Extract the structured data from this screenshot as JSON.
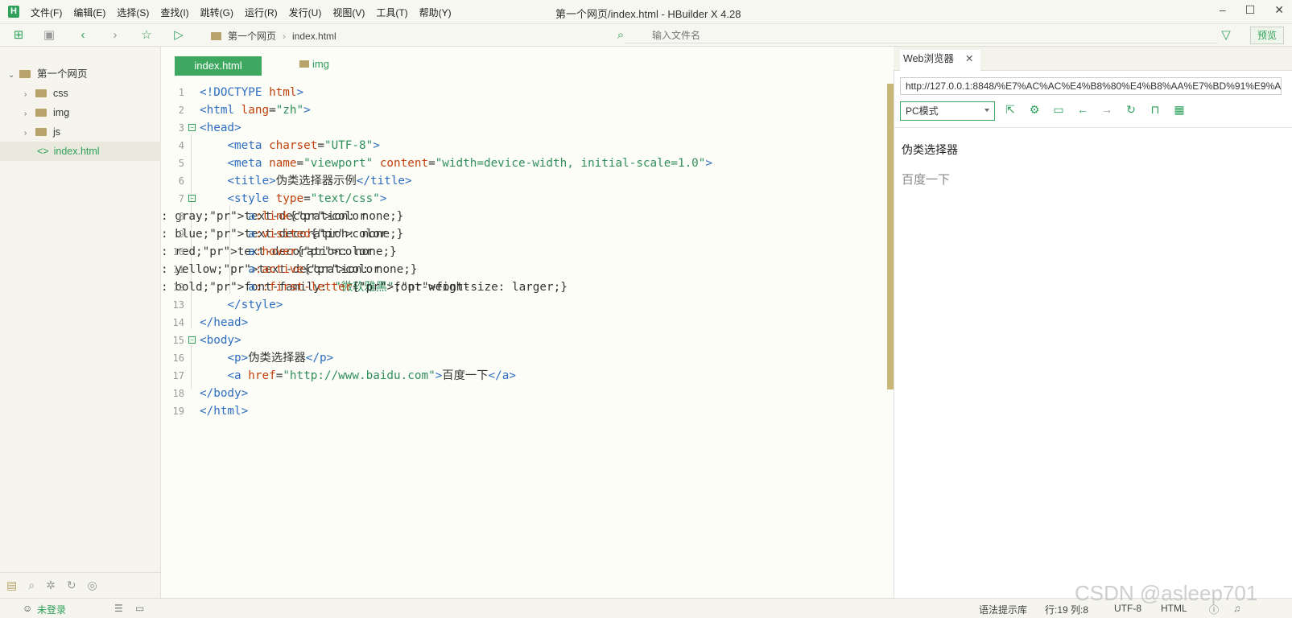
{
  "app": {
    "logo": "H",
    "title": "第一个网页/index.html - HBuilder X 4.28"
  },
  "menu": [
    "文件(F)",
    "编辑(E)",
    "选择(S)",
    "查找(I)",
    "跳转(G)",
    "运行(R)",
    "发行(U)",
    "视图(V)",
    "工具(T)",
    "帮助(Y)"
  ],
  "toolbar": {
    "crumb_project": "第一个网页",
    "crumb_file": "index.html",
    "search_placeholder": "输入文件名",
    "preview_label": "预览"
  },
  "sidebar": {
    "project": "第一个网页",
    "items": [
      {
        "label": "css"
      },
      {
        "label": "img"
      },
      {
        "label": "js"
      },
      {
        "label": "index.html"
      }
    ]
  },
  "tabs": [
    {
      "label": "index.html"
    },
    {
      "label": "img"
    }
  ],
  "code_lines": [
    "<!DOCTYPE html>",
    "<html lang=\"zh\">",
    "<head>",
    "    <meta charset=\"UTF-8\">",
    "    <meta name=\"viewport\" content=\"width=device-width, initial-scale=1.0\">",
    "    <title>伪类选择器示例</title>",
    "    <style type=\"text/css\">",
    "       a:link{color: gray;text-decoration: none;}",
    "       a:visited{color: blue;text-decoration: none;}",
    "       a:hover{color: red;text-decoration: none;}",
    "       a:active{color: yellow;text-decoration: none;}",
    "       a::first-letter{font-weight: bold;font-family: \"微软雅黑\";font-size: larger;}",
    "    </style>",
    "</head>",
    "<body>",
    "    <p>伪类选择器</p>",
    "    <a href=\"http://www.baidu.com\">百度一下</a>",
    "</body>",
    "</html>"
  ],
  "browser": {
    "tab_label": "Web浏览器",
    "url": "http://127.0.0.1:8848/%E7%AC%AC%E4%B8%80%E4%B8%AA%E7%BD%91%E9%A1%B5/index.html",
    "mode": "PC模式",
    "page_paragraph": "伪类选择器",
    "page_link": "百度一下"
  },
  "status": {
    "login": "未登录",
    "lint": "语法提示库",
    "position": "行:19  列:8",
    "encoding": "UTF-8",
    "language": "HTML"
  },
  "watermark": "CSDN @asleep701",
  "colors": {
    "accent": "#3ea860",
    "tag": "#2e6ec0",
    "attr": "#c2410c",
    "string": "#2f8f5a"
  }
}
